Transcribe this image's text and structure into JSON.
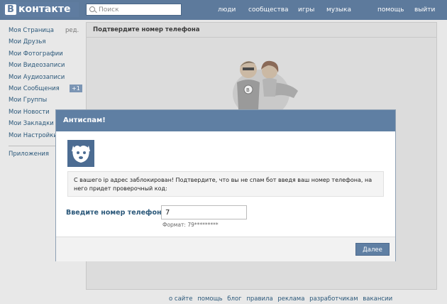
{
  "header": {
    "logo_letter": "В",
    "logo_text": "контакте",
    "search_placeholder": "Поиск",
    "nav": [
      "люди",
      "сообщества",
      "игры",
      "музыка",
      "помощь",
      "выйти"
    ]
  },
  "sidebar": {
    "items": [
      {
        "label": "Моя Страница",
        "extra": "ред."
      },
      {
        "label": "Мои Друзья"
      },
      {
        "label": "Мои Фотографии"
      },
      {
        "label": "Мои Видеозаписи"
      },
      {
        "label": "Мои Аудиозаписи"
      },
      {
        "label": "Мои Сообщения",
        "badge": "+1"
      },
      {
        "label": "Мои Группы"
      },
      {
        "label": "Мои Новости"
      },
      {
        "label": "Мои Закладки"
      },
      {
        "label": "Мои Настройки"
      }
    ],
    "apps": "Приложения"
  },
  "main": {
    "title": "Подтвердите номер телефона"
  },
  "dialog": {
    "title": "Антиспам!",
    "message": "С вашего ip адрес заблокирован! Подтвердите, что вы не спам бот введя ваш номер телефона, на него придет проверочный код:",
    "phone_label": "Введите номер телефона:",
    "phone_value": "7",
    "format_hint": "Формат: 79*********",
    "next_button": "Далее"
  },
  "footer": {
    "links": [
      "о сайте",
      "помощь",
      "блог",
      "правила",
      "реклама",
      "разработчикам",
      "вакансии"
    ]
  },
  "colors": {
    "header": "#5d7a9c",
    "link": "#2b587a",
    "dialog_header": "#5f7fa3"
  }
}
